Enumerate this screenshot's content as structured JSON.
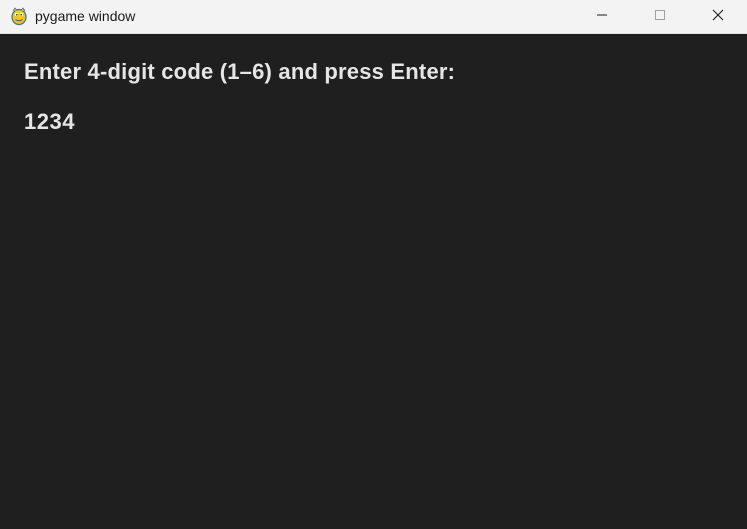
{
  "window": {
    "title": "pygame window",
    "app_icon": "pygame-snake-icon",
    "controls": {
      "minimize_icon": "minimize-icon",
      "maximize_icon": "maximize-icon",
      "close_icon": "close-icon"
    }
  },
  "game": {
    "prompt": "Enter 4-digit code (1–6) and press Enter:",
    "code_input": "1234"
  },
  "colors": {
    "background": "#1f1f1f",
    "text": "#e6e6e6",
    "titlebar": "#f3f3f3"
  }
}
